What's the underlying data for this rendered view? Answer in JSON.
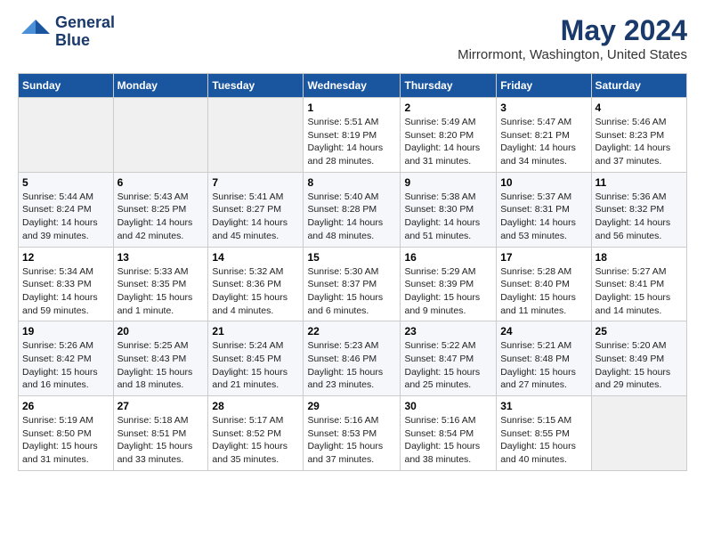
{
  "header": {
    "logo_line1": "General",
    "logo_line2": "Blue",
    "main_title": "May 2024",
    "subtitle": "Mirrormont, Washington, United States"
  },
  "columns": [
    "Sunday",
    "Monday",
    "Tuesday",
    "Wednesday",
    "Thursday",
    "Friday",
    "Saturday"
  ],
  "weeks": [
    [
      {
        "day": "",
        "info": ""
      },
      {
        "day": "",
        "info": ""
      },
      {
        "day": "",
        "info": ""
      },
      {
        "day": "1",
        "info": "Sunrise: 5:51 AM\nSunset: 8:19 PM\nDaylight: 14 hours\nand 28 minutes."
      },
      {
        "day": "2",
        "info": "Sunrise: 5:49 AM\nSunset: 8:20 PM\nDaylight: 14 hours\nand 31 minutes."
      },
      {
        "day": "3",
        "info": "Sunrise: 5:47 AM\nSunset: 8:21 PM\nDaylight: 14 hours\nand 34 minutes."
      },
      {
        "day": "4",
        "info": "Sunrise: 5:46 AM\nSunset: 8:23 PM\nDaylight: 14 hours\nand 37 minutes."
      }
    ],
    [
      {
        "day": "5",
        "info": "Sunrise: 5:44 AM\nSunset: 8:24 PM\nDaylight: 14 hours\nand 39 minutes."
      },
      {
        "day": "6",
        "info": "Sunrise: 5:43 AM\nSunset: 8:25 PM\nDaylight: 14 hours\nand 42 minutes."
      },
      {
        "day": "7",
        "info": "Sunrise: 5:41 AM\nSunset: 8:27 PM\nDaylight: 14 hours\nand 45 minutes."
      },
      {
        "day": "8",
        "info": "Sunrise: 5:40 AM\nSunset: 8:28 PM\nDaylight: 14 hours\nand 48 minutes."
      },
      {
        "day": "9",
        "info": "Sunrise: 5:38 AM\nSunset: 8:30 PM\nDaylight: 14 hours\nand 51 minutes."
      },
      {
        "day": "10",
        "info": "Sunrise: 5:37 AM\nSunset: 8:31 PM\nDaylight: 14 hours\nand 53 minutes."
      },
      {
        "day": "11",
        "info": "Sunrise: 5:36 AM\nSunset: 8:32 PM\nDaylight: 14 hours\nand 56 minutes."
      }
    ],
    [
      {
        "day": "12",
        "info": "Sunrise: 5:34 AM\nSunset: 8:33 PM\nDaylight: 14 hours\nand 59 minutes."
      },
      {
        "day": "13",
        "info": "Sunrise: 5:33 AM\nSunset: 8:35 PM\nDaylight: 15 hours\nand 1 minute."
      },
      {
        "day": "14",
        "info": "Sunrise: 5:32 AM\nSunset: 8:36 PM\nDaylight: 15 hours\nand 4 minutes."
      },
      {
        "day": "15",
        "info": "Sunrise: 5:30 AM\nSunset: 8:37 PM\nDaylight: 15 hours\nand 6 minutes."
      },
      {
        "day": "16",
        "info": "Sunrise: 5:29 AM\nSunset: 8:39 PM\nDaylight: 15 hours\nand 9 minutes."
      },
      {
        "day": "17",
        "info": "Sunrise: 5:28 AM\nSunset: 8:40 PM\nDaylight: 15 hours\nand 11 minutes."
      },
      {
        "day": "18",
        "info": "Sunrise: 5:27 AM\nSunset: 8:41 PM\nDaylight: 15 hours\nand 14 minutes."
      }
    ],
    [
      {
        "day": "19",
        "info": "Sunrise: 5:26 AM\nSunset: 8:42 PM\nDaylight: 15 hours\nand 16 minutes."
      },
      {
        "day": "20",
        "info": "Sunrise: 5:25 AM\nSunset: 8:43 PM\nDaylight: 15 hours\nand 18 minutes."
      },
      {
        "day": "21",
        "info": "Sunrise: 5:24 AM\nSunset: 8:45 PM\nDaylight: 15 hours\nand 21 minutes."
      },
      {
        "day": "22",
        "info": "Sunrise: 5:23 AM\nSunset: 8:46 PM\nDaylight: 15 hours\nand 23 minutes."
      },
      {
        "day": "23",
        "info": "Sunrise: 5:22 AM\nSunset: 8:47 PM\nDaylight: 15 hours\nand 25 minutes."
      },
      {
        "day": "24",
        "info": "Sunrise: 5:21 AM\nSunset: 8:48 PM\nDaylight: 15 hours\nand 27 minutes."
      },
      {
        "day": "25",
        "info": "Sunrise: 5:20 AM\nSunset: 8:49 PM\nDaylight: 15 hours\nand 29 minutes."
      }
    ],
    [
      {
        "day": "26",
        "info": "Sunrise: 5:19 AM\nSunset: 8:50 PM\nDaylight: 15 hours\nand 31 minutes."
      },
      {
        "day": "27",
        "info": "Sunrise: 5:18 AM\nSunset: 8:51 PM\nDaylight: 15 hours\nand 33 minutes."
      },
      {
        "day": "28",
        "info": "Sunrise: 5:17 AM\nSunset: 8:52 PM\nDaylight: 15 hours\nand 35 minutes."
      },
      {
        "day": "29",
        "info": "Sunrise: 5:16 AM\nSunset: 8:53 PM\nDaylight: 15 hours\nand 37 minutes."
      },
      {
        "day": "30",
        "info": "Sunrise: 5:16 AM\nSunset: 8:54 PM\nDaylight: 15 hours\nand 38 minutes."
      },
      {
        "day": "31",
        "info": "Sunrise: 5:15 AM\nSunset: 8:55 PM\nDaylight: 15 hours\nand 40 minutes."
      },
      {
        "day": "",
        "info": ""
      }
    ]
  ]
}
